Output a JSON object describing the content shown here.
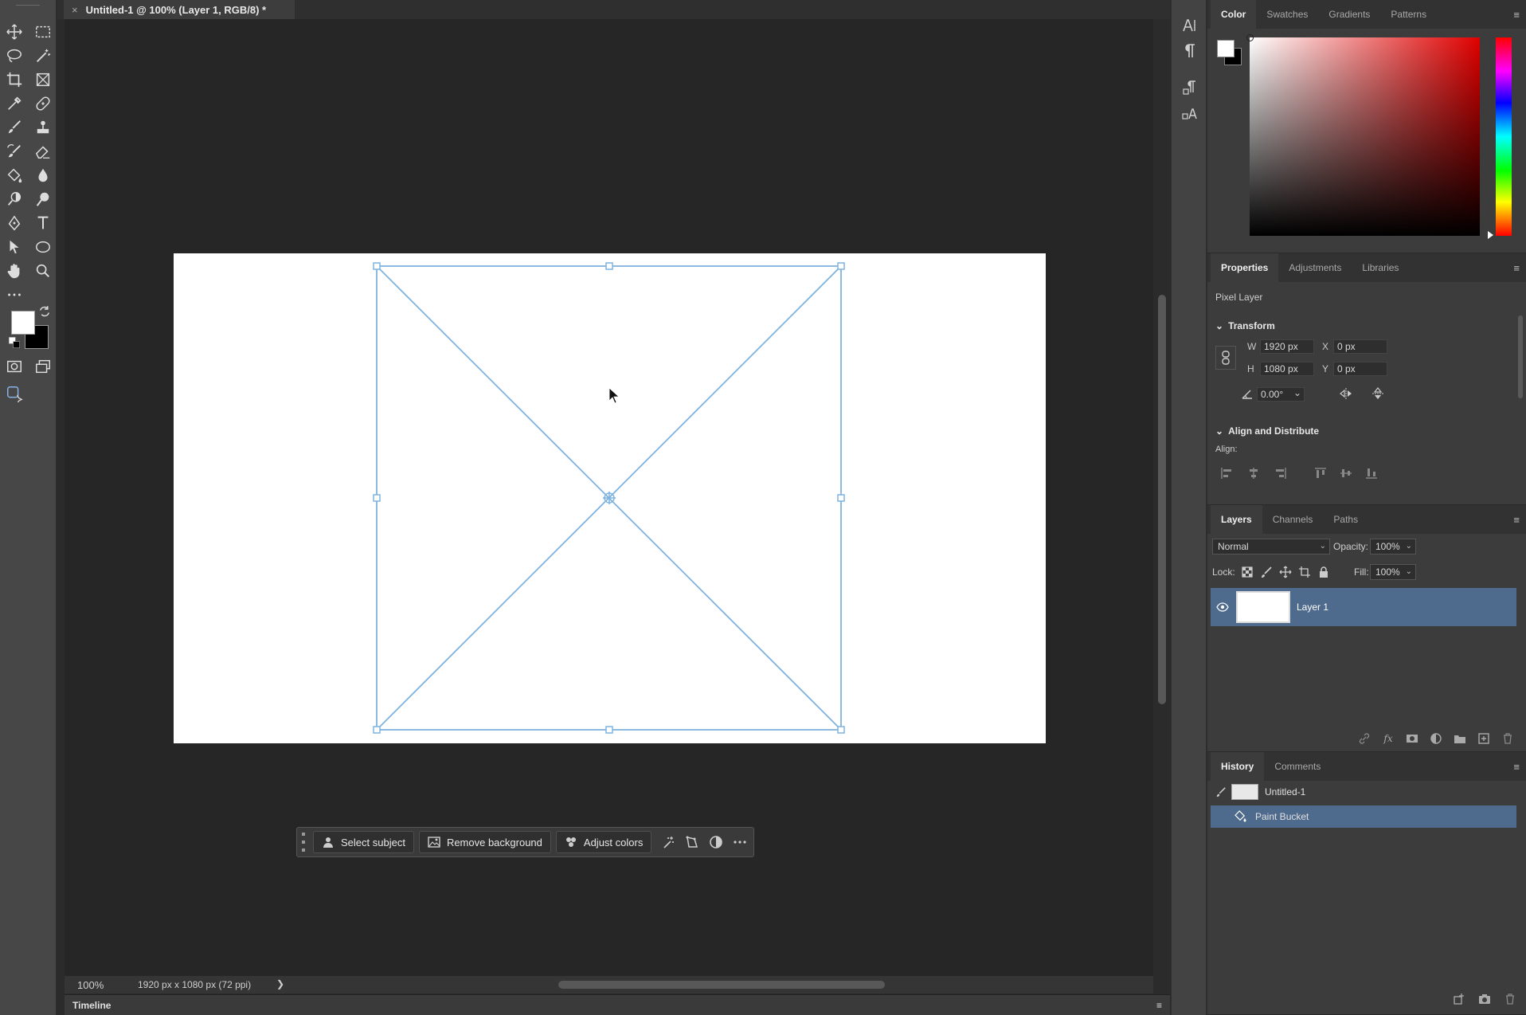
{
  "document": {
    "tab_title": "Untitled-1 @ 100% (Layer 1, RGB/8) *",
    "close_glyph": "×"
  },
  "toolbar": {
    "tools": [
      {
        "name": "move-tool-icon",
        "glyph": "✥"
      },
      {
        "name": "rectangular-marquee-icon",
        "glyph": "⬚"
      },
      {
        "name": "lasso-icon",
        "glyph": "◯"
      },
      {
        "name": "magic-wand-icon",
        "glyph": "✦"
      },
      {
        "name": "crop-icon",
        "glyph": "⌗"
      },
      {
        "name": "frame-icon",
        "glyph": "⊠"
      },
      {
        "name": "eyedropper-icon",
        "glyph": "⁄"
      },
      {
        "name": "healing-brush-icon",
        "glyph": "✚"
      },
      {
        "name": "brush-icon",
        "glyph": "✎"
      },
      {
        "name": "clone-stamp-icon",
        "glyph": "⊥"
      },
      {
        "name": "history-brush-icon",
        "glyph": "↺"
      },
      {
        "name": "eraser-icon",
        "glyph": "◩"
      },
      {
        "name": "paint-bucket-icon",
        "glyph": "◈"
      },
      {
        "name": "blur-icon",
        "glyph": "●"
      },
      {
        "name": "dodge-icon",
        "glyph": "◐"
      },
      {
        "name": "sponge-icon",
        "glyph": "⚲"
      },
      {
        "name": "pen-icon",
        "glyph": "✒"
      },
      {
        "name": "type-icon",
        "glyph": "T"
      },
      {
        "name": "path-selection-icon",
        "glyph": "➤"
      },
      {
        "name": "ellipse-icon",
        "glyph": "⬭"
      },
      {
        "name": "hand-icon",
        "glyph": "✋"
      },
      {
        "name": "zoom-icon",
        "glyph": "⚲"
      },
      {
        "name": "more-tools-icon",
        "glyph": "•••"
      },
      {
        "name": "swap-colors-icon",
        "glyph": "⤾"
      },
      {
        "name": "default-colors-icon",
        "glyph": "◪"
      },
      {
        "name": "quick-mask-icon",
        "glyph": "◎"
      },
      {
        "name": "screen-mode-icon",
        "glyph": "⧉"
      },
      {
        "name": "generative-icon",
        "glyph": "✧"
      }
    ],
    "foreground_color": "#ffffff",
    "background_color": "#000000"
  },
  "contextual_taskbar": {
    "buttons": [
      {
        "label": "Select subject",
        "icon": "person-icon"
      },
      {
        "label": "Remove background",
        "icon": "image-icon"
      },
      {
        "label": "Adjust colors",
        "icon": "circles-icon"
      }
    ],
    "icons": [
      "sparkle-icon",
      "transform-icon",
      "contrast-icon",
      "more-icon"
    ]
  },
  "status": {
    "zoom": "100%",
    "doc_info": "1920 px x 1080 px (72 ppi)",
    "arrow": "❯"
  },
  "timeline": {
    "label": "Timeline",
    "menu": "≡"
  },
  "mini_strip": {
    "items": [
      "A|",
      "¶",
      "⚙¶",
      "⚙A"
    ]
  },
  "color_panel": {
    "tabs": [
      "Color",
      "Swatches",
      "Gradients",
      "Patterns"
    ],
    "active_tab": "Color",
    "hue": "#e00000"
  },
  "properties_panel": {
    "tabs": [
      "Properties",
      "Adjustments",
      "Libraries"
    ],
    "active_tab": "Properties",
    "kind": "Pixel Layer",
    "transform_label": "Transform",
    "w_label": "W",
    "w_value": "1920 px",
    "h_label": "H",
    "h_value": "1080 px",
    "x_label": "X",
    "x_value": "0 px",
    "y_label": "Y",
    "y_value": "0 px",
    "angle_value": "0.00°",
    "align_distribute_label": "Align and Distribute",
    "align_label": "Align:"
  },
  "layers_panel": {
    "tabs": [
      "Layers",
      "Channels",
      "Paths"
    ],
    "active_tab": "Layers",
    "blend_mode": "Normal",
    "opacity_label": "Opacity:",
    "opacity_value": "100%",
    "lock_label": "Lock:",
    "fill_label": "Fill:",
    "fill_value": "100%",
    "layers": [
      {
        "name": "Layer 1",
        "visible": true,
        "selected": true
      }
    ],
    "footer_icons": [
      "link-icon",
      "fx-icon",
      "mask-icon",
      "adjustment-icon",
      "group-icon",
      "new-layer-icon",
      "delete-icon"
    ]
  },
  "history_panel": {
    "tabs": [
      "History",
      "Comments"
    ],
    "active_tab": "History",
    "snapshot": "Untitled-1",
    "states": [
      {
        "name": "Paint Bucket",
        "selected": true
      }
    ]
  },
  "colors": {
    "accent_selection": "#4e6a8c",
    "transform_box": "#7fb3e0"
  }
}
